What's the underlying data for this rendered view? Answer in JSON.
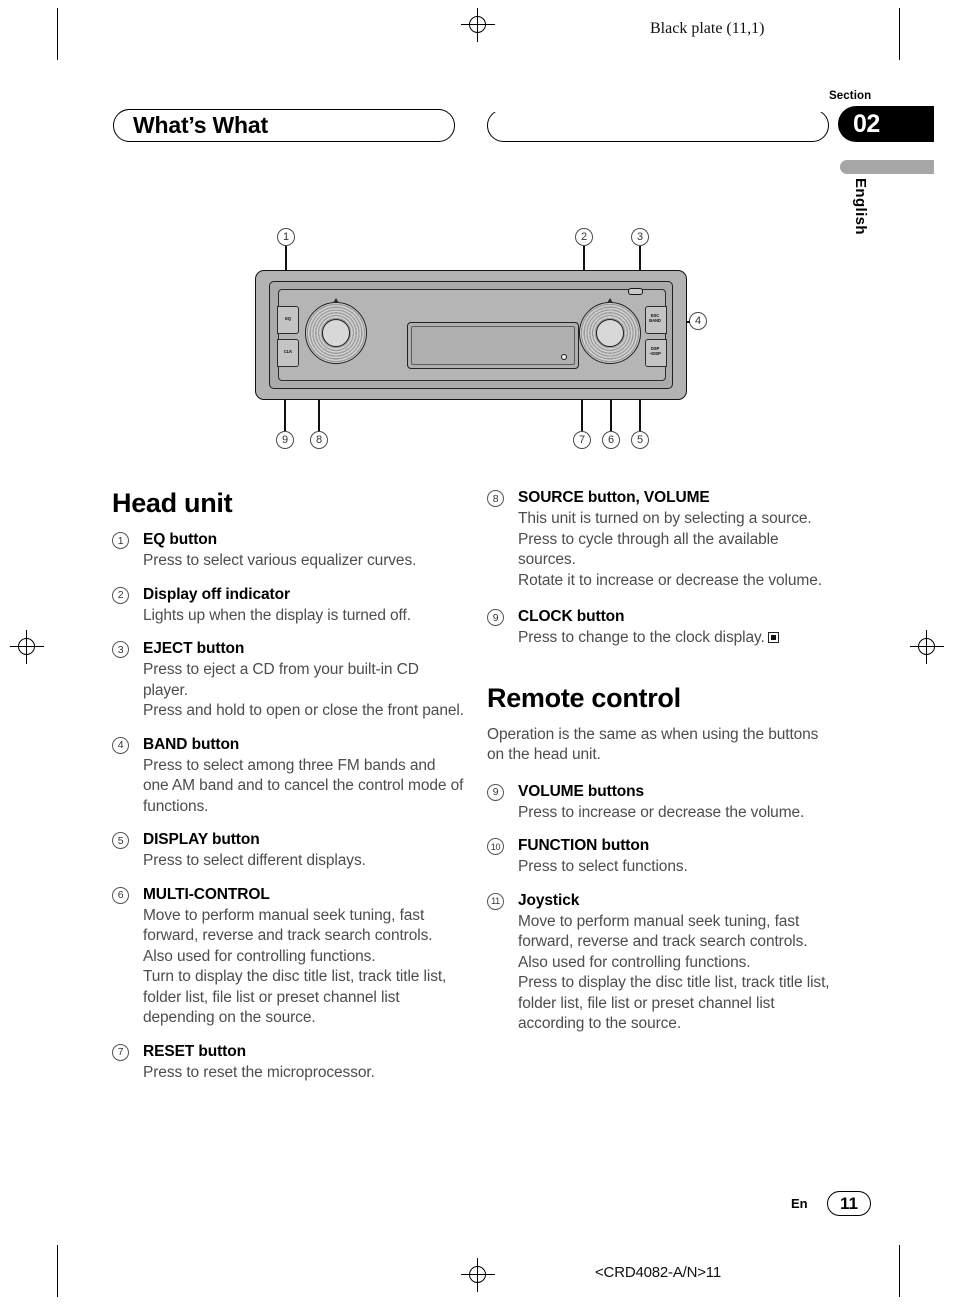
{
  "page": {
    "plate_note": "Black plate (11,1)",
    "section_label": "Section",
    "section_number": "02",
    "language_tab": "English",
    "chapter_title": "What’s What",
    "footer_lang": "En",
    "footer_page": "11",
    "footer_code": "<CRD4082-A/N>11"
  },
  "diagram": {
    "name": "head-unit-faceplate",
    "callouts": [
      "1",
      "2",
      "3",
      "4",
      "5",
      "6",
      "7",
      "8",
      "9"
    ],
    "panel_labels": {
      "eq": "EQ",
      "clk": "CLK",
      "esc_band": "ESC\nBAND",
      "disp": "DSP\n-DISP"
    }
  },
  "head_unit": {
    "heading": "Head unit",
    "items": [
      {
        "num": "1",
        "term": "EQ button",
        "desc": "Press to select various equalizer curves."
      },
      {
        "num": "2",
        "term": "Display off indicator",
        "desc": "Lights up when the display is turned off."
      },
      {
        "num": "3",
        "term": "EJECT button",
        "desc": "Press to eject a CD from your built-in CD player.\nPress and hold to open or close the front panel."
      },
      {
        "num": "4",
        "term": "BAND button",
        "desc": "Press to select among three FM bands and one AM band and to cancel the control mode of functions."
      },
      {
        "num": "5",
        "term": "DISPLAY button",
        "desc": "Press to select different displays."
      },
      {
        "num": "6",
        "term": "MULTI-CONTROL",
        "desc": "Move to perform manual seek tuning, fast forward, reverse and track search controls. Also used for controlling functions.\nTurn to display the disc title list, track title list, folder list, file list or preset channel list depending on the source."
      },
      {
        "num": "7",
        "term": "RESET button",
        "desc": "Press to reset the microprocessor."
      },
      {
        "num": "8",
        "term": "SOURCE button, VOLUME",
        "desc": "This unit is turned on by selecting a source.\nPress to cycle through all the available sources.\nRotate it to increase or decrease the volume."
      },
      {
        "num": "9",
        "term": "CLOCK button",
        "desc": "Press to change to the clock display."
      }
    ]
  },
  "remote_control": {
    "heading": "Remote control",
    "intro": "Operation is the same as when using the buttons on the head unit.",
    "items": [
      {
        "num": "9",
        "term": "VOLUME buttons",
        "desc": "Press to increase or decrease the volume."
      },
      {
        "num": "10",
        "term": "FUNCTION button",
        "desc": "Press to select functions."
      },
      {
        "num": "11",
        "term": "Joystick",
        "desc": "Move to perform manual seek tuning, fast forward, reverse and track search controls. Also used for controlling functions.\nPress to display the disc title list, track title list, folder list, file list or preset channel list according to the source."
      }
    ]
  }
}
